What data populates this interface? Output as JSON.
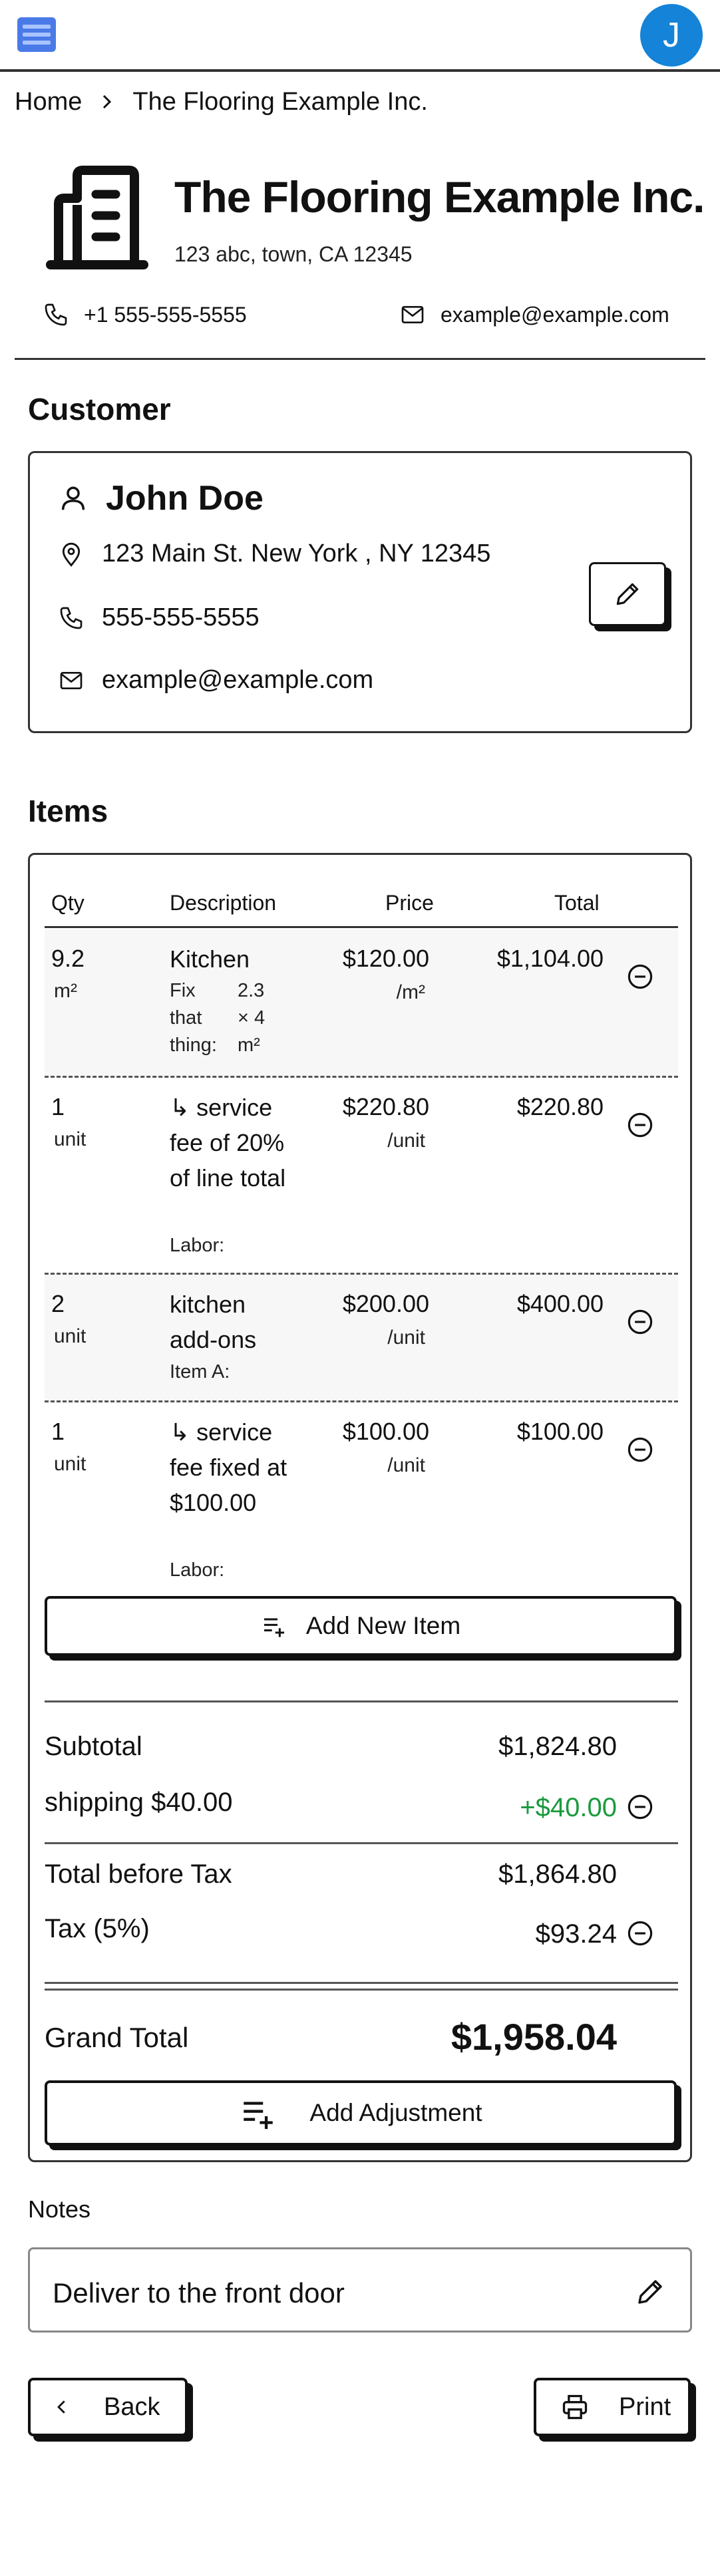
{
  "topbar": {
    "avatar_initial": "J",
    "icons": [
      "menu-icon"
    ]
  },
  "breadcrumb": {
    "home": "Home",
    "current": "The Flooring Example Inc."
  },
  "company": {
    "name": "The Flooring Example Inc.",
    "address": "123 abc,  town, CA 12345",
    "phone": "+1 555-555-5555",
    "email": "example@example.com",
    "icons": [
      "building-icon",
      "phone-icon",
      "mail-icon"
    ]
  },
  "customer": {
    "section_title": "Customer",
    "name": "John Doe",
    "address": "123 Main St.  New York , NY 12345",
    "phone": "555-555-5555",
    "email": "example@example.com",
    "icons": [
      "person-icon",
      "location-pin-icon",
      "phone-icon",
      "mail-icon",
      "pencil-icon"
    ]
  },
  "items": {
    "section_title": "Items",
    "columns": {
      "qty": "Qty",
      "description": "Description",
      "price": "Price",
      "total": "Total"
    },
    "rows": [
      {
        "qty": "9.2",
        "unit": "m²",
        "description": "Kitchen",
        "sub_label": "Fix that thing:",
        "sub_detail": "2.3 × 4 m²",
        "price": "$120.00",
        "per": "/m²",
        "total": "$1,104.00"
      },
      {
        "qty": "1",
        "unit": "unit",
        "description": "↳ service fee of 20% of line total",
        "sub_label": "Labor:",
        "sub_detail": "",
        "price": "$220.80",
        "per": "/unit",
        "total": "$220.80"
      },
      {
        "qty": "2",
        "unit": "unit",
        "description": "kitchen add-ons",
        "sub_label": "Item A:",
        "sub_detail": "",
        "price": "$200.00",
        "per": "/unit",
        "total": "$400.00"
      },
      {
        "qty": "1",
        "unit": "unit",
        "description": "↳ service fee fixed at $100.00",
        "sub_label": "Labor:",
        "sub_detail": "",
        "price": "$100.00",
        "per": "/unit",
        "total": "$100.00"
      }
    ],
    "add_item_label": "Add New Item"
  },
  "totals": {
    "subtotal_label": "Subtotal",
    "subtotal_value": "$1,824.80",
    "shipping_label": "shipping $40.00",
    "shipping_value": "+$40.00",
    "before_tax_label": "Total before Tax",
    "before_tax_value": "$1,864.80",
    "tax_label": "Tax (5%)",
    "tax_value": "$93.24",
    "grand_label": "Grand Total",
    "grand_value": "$1,958.04",
    "add_adjustment_label": "Add Adjustment",
    "accent_green": "#1b9a3e"
  },
  "notes": {
    "label": "Notes",
    "text": "Deliver to the front door"
  },
  "footer": {
    "back_label": "Back",
    "print_label": "Print"
  },
  "colors": {
    "avatar": "#1483d8",
    "menu_icon": "#4a7ae8"
  }
}
